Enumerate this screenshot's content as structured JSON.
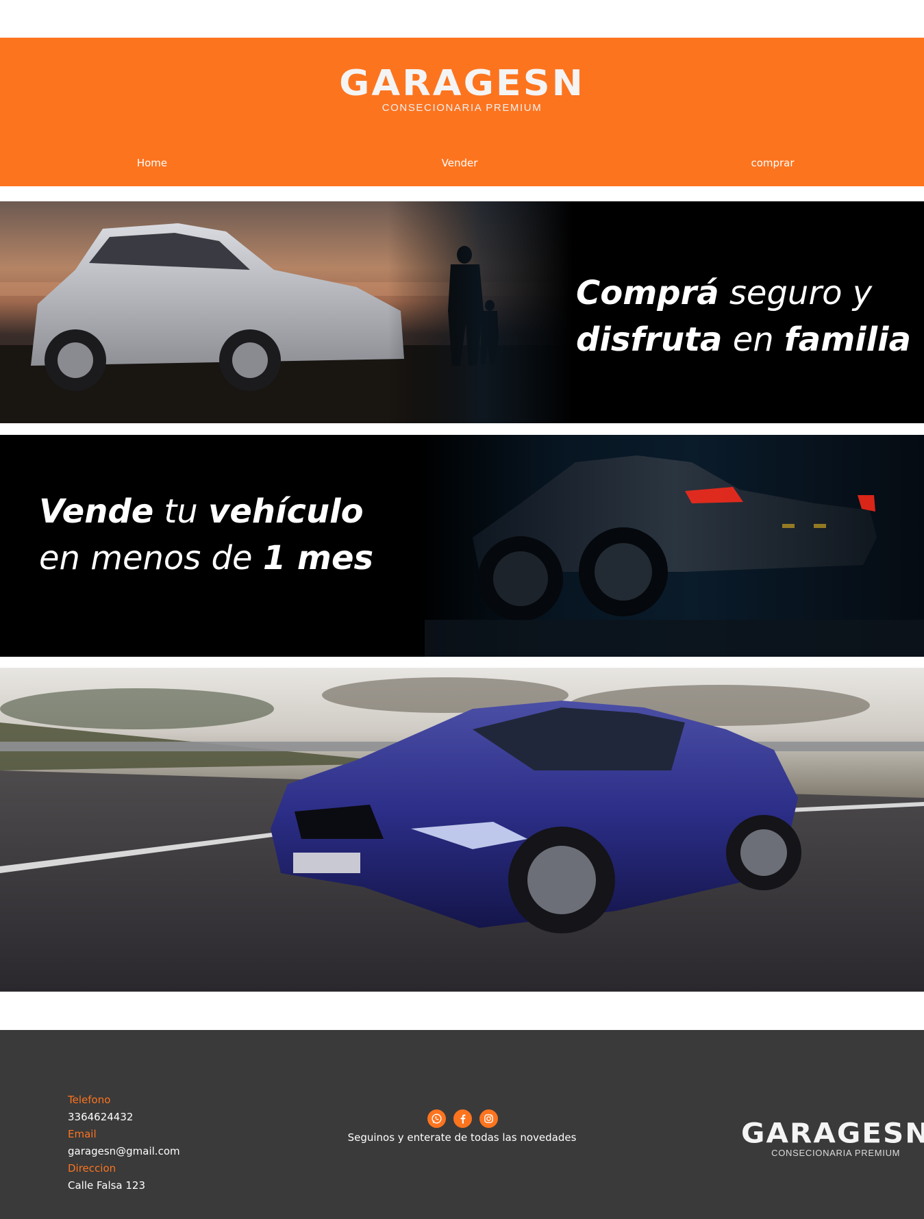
{
  "brand": {
    "name": "GARAGESN",
    "tagline": "CONSECIONARIA PREMIUM"
  },
  "nav": {
    "items": [
      {
        "label": "Home"
      },
      {
        "label": "Vender"
      },
      {
        "label": "comprar"
      }
    ]
  },
  "banners": {
    "buy": {
      "line1_bold": "Comprá",
      "line1_rest": " seguro y",
      "line2_bold": "disfruta",
      "line2_mid": " en ",
      "line2_bold2": "familia"
    },
    "sell": {
      "line1_bold": "Vende",
      "line1_mid": " tu ",
      "line1_bold2": "vehículo",
      "line2_rest": "en menos de ",
      "line2_bold": "1 mes"
    }
  },
  "footer": {
    "phone_label": "Telefono",
    "phone": "3364624432",
    "email_label": "Email",
    "email": "garagesn@gmail.com",
    "address_label": "Direccion",
    "address": "Calle Falsa 123",
    "social_text": "Seguinos y enterate de todas las novedades",
    "social_icons": [
      "whatsapp-icon",
      "facebook-icon",
      "instagram-icon"
    ]
  },
  "colors": {
    "accent": "#fd741f",
    "footer_bg": "#3a3a3a"
  }
}
